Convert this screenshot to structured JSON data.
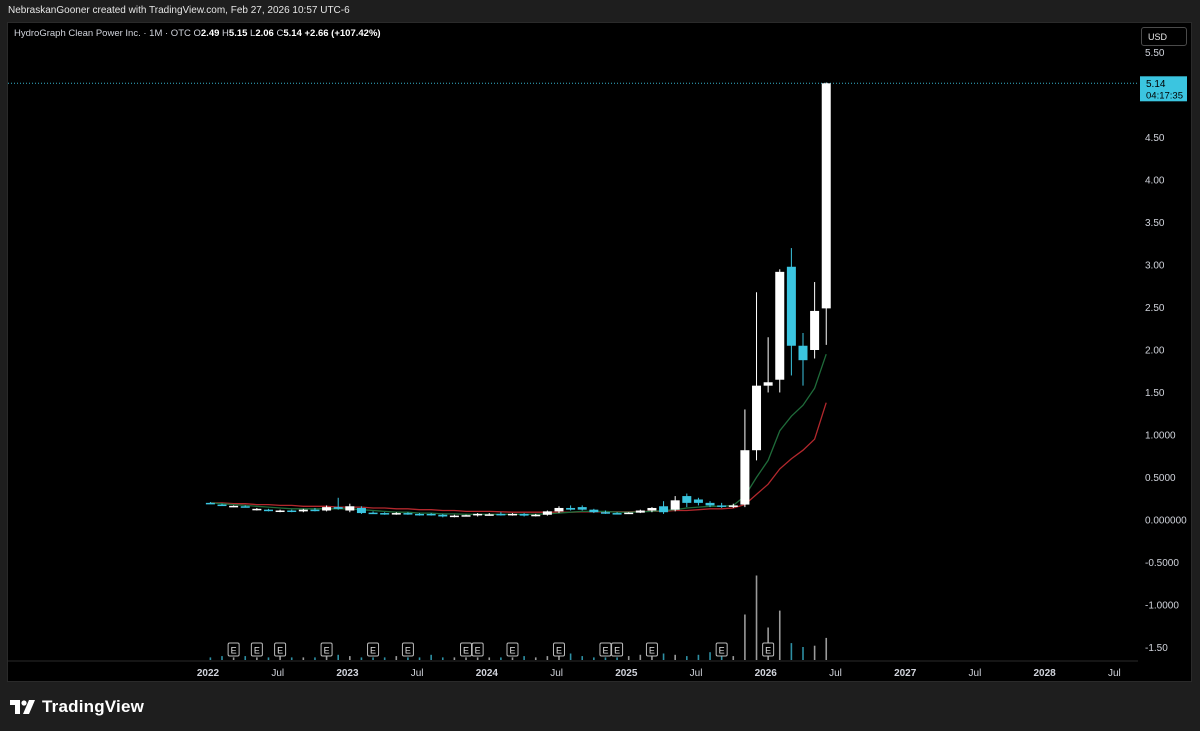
{
  "header": {
    "attribution": "NebraskanGooner created with TradingView.com, Feb 27, 2026 10:57 UTC-6"
  },
  "legend": {
    "symbol": "HydroGraph Clean Power Inc. · 1M · OTC",
    "o_label": "O",
    "o": "2.49",
    "h_label": "H",
    "h": "5.15",
    "l_label": "L",
    "l": "2.06",
    "c_label": "C",
    "c": "5.14",
    "change": "+2.66 (+107.42%)"
  },
  "currency_button": "USD",
  "price_tag": {
    "price": "5.14",
    "countdown": "04:17:35"
  },
  "brand": "TradingView",
  "colors": {
    "background": "#000000",
    "up_candle": "#ffffff",
    "down_candle": "#3bc5e0",
    "ema_fast": "#1f6b3a",
    "ema_slow": "#b3282d",
    "price_line": "#3bc5e0",
    "volume": "#8c8c8c"
  },
  "chart_data": {
    "type": "candlestick",
    "interval": "1M",
    "y_range": [
      -1.65,
      5.85
    ],
    "y_ticks": [
      "5.50",
      "4.50",
      "4.00",
      "3.50",
      "3.00",
      "2.50",
      "2.00",
      "1.50",
      "1.0000",
      "0.5000",
      "0.000000",
      "-0.5000",
      "-1.0000",
      "-1.50"
    ],
    "x_ticks": [
      {
        "label": "2022",
        "month": 0
      },
      {
        "label": "Jul",
        "month": 6
      },
      {
        "label": "2023",
        "month": 12
      },
      {
        "label": "Jul",
        "month": 18
      },
      {
        "label": "2024",
        "month": 24
      },
      {
        "label": "Jul",
        "month": 30
      },
      {
        "label": "2025",
        "month": 36
      },
      {
        "label": "Jul",
        "month": 42
      },
      {
        "label": "2026",
        "month": 48
      },
      {
        "label": "Jul",
        "month": 54
      },
      {
        "label": "2027",
        "month": 60
      },
      {
        "label": "Jul",
        "month": 66
      },
      {
        "label": "2028",
        "month": 72
      },
      {
        "label": "Jul",
        "month": 78
      }
    ],
    "candles": [
      {
        "date": "2021-12",
        "o": 0.2,
        "h": 0.21,
        "l": 0.19,
        "c": 0.195
      },
      {
        "date": "2022-01",
        "o": 0.18,
        "h": 0.19,
        "l": 0.17,
        "c": 0.175
      },
      {
        "date": "2022-02",
        "o": 0.16,
        "h": 0.17,
        "l": 0.15,
        "c": 0.165
      },
      {
        "date": "2022-03",
        "o": 0.16,
        "h": 0.17,
        "l": 0.15,
        "c": 0.155
      },
      {
        "date": "2022-04",
        "o": 0.12,
        "h": 0.14,
        "l": 0.11,
        "c": 0.13
      },
      {
        "date": "2022-05",
        "o": 0.12,
        "h": 0.13,
        "l": 0.1,
        "c": 0.105
      },
      {
        "date": "2022-06",
        "o": 0.105,
        "h": 0.12,
        "l": 0.09,
        "c": 0.11
      },
      {
        "date": "2022-07",
        "o": 0.11,
        "h": 0.12,
        "l": 0.09,
        "c": 0.1
      },
      {
        "date": "2022-08",
        "o": 0.1,
        "h": 0.13,
        "l": 0.09,
        "c": 0.12
      },
      {
        "date": "2022-09",
        "o": 0.12,
        "h": 0.14,
        "l": 0.1,
        "c": 0.11
      },
      {
        "date": "2022-10",
        "o": 0.11,
        "h": 0.17,
        "l": 0.1,
        "c": 0.15
      },
      {
        "date": "2022-11",
        "o": 0.15,
        "h": 0.26,
        "l": 0.12,
        "c": 0.13
      },
      {
        "date": "2022-12",
        "o": 0.11,
        "h": 0.19,
        "l": 0.09,
        "c": 0.16
      },
      {
        "date": "2023-01",
        "o": 0.14,
        "h": 0.16,
        "l": 0.07,
        "c": 0.08
      },
      {
        "date": "2023-02",
        "o": 0.085,
        "h": 0.1,
        "l": 0.07,
        "c": 0.08
      },
      {
        "date": "2023-03",
        "o": 0.08,
        "h": 0.09,
        "l": 0.06,
        "c": 0.075
      },
      {
        "date": "2023-04",
        "o": 0.07,
        "h": 0.09,
        "l": 0.06,
        "c": 0.08
      },
      {
        "date": "2023-05",
        "o": 0.08,
        "h": 0.09,
        "l": 0.06,
        "c": 0.07
      },
      {
        "date": "2023-06",
        "o": 0.07,
        "h": 0.08,
        "l": 0.05,
        "c": 0.06
      },
      {
        "date": "2023-07",
        "o": 0.07,
        "h": 0.08,
        "l": 0.05,
        "c": 0.055
      },
      {
        "date": "2023-08",
        "o": 0.06,
        "h": 0.07,
        "l": 0.03,
        "c": 0.04
      },
      {
        "date": "2023-09",
        "o": 0.04,
        "h": 0.06,
        "l": 0.03,
        "c": 0.05
      },
      {
        "date": "2023-10",
        "o": 0.05,
        "h": 0.06,
        "l": 0.04,
        "c": 0.055
      },
      {
        "date": "2023-11",
        "o": 0.055,
        "h": 0.08,
        "l": 0.04,
        "c": 0.07
      },
      {
        "date": "2023-12",
        "o": 0.06,
        "h": 0.08,
        "l": 0.05,
        "c": 0.065
      },
      {
        "date": "2024-01",
        "o": 0.07,
        "h": 0.09,
        "l": 0.05,
        "c": 0.06
      },
      {
        "date": "2024-02",
        "o": 0.06,
        "h": 0.08,
        "l": 0.05,
        "c": 0.07
      },
      {
        "date": "2024-03",
        "o": 0.07,
        "h": 0.08,
        "l": 0.04,
        "c": 0.05
      },
      {
        "date": "2024-04",
        "o": 0.05,
        "h": 0.07,
        "l": 0.04,
        "c": 0.06
      },
      {
        "date": "2024-05",
        "o": 0.06,
        "h": 0.11,
        "l": 0.05,
        "c": 0.1
      },
      {
        "date": "2024-06",
        "o": 0.1,
        "h": 0.16,
        "l": 0.08,
        "c": 0.14
      },
      {
        "date": "2024-07",
        "o": 0.14,
        "h": 0.17,
        "l": 0.11,
        "c": 0.12
      },
      {
        "date": "2024-08",
        "o": 0.15,
        "h": 0.17,
        "l": 0.11,
        "c": 0.12
      },
      {
        "date": "2024-09",
        "o": 0.12,
        "h": 0.13,
        "l": 0.08,
        "c": 0.09
      },
      {
        "date": "2024-10",
        "o": 0.09,
        "h": 0.11,
        "l": 0.07,
        "c": 0.08
      },
      {
        "date": "2024-11",
        "o": 0.08,
        "h": 0.09,
        "l": 0.07,
        "c": 0.075
      },
      {
        "date": "2024-12",
        "o": 0.08,
        "h": 0.09,
        "l": 0.07,
        "c": 0.085
      },
      {
        "date": "2025-01",
        "o": 0.085,
        "h": 0.12,
        "l": 0.08,
        "c": 0.11
      },
      {
        "date": "2025-02",
        "o": 0.11,
        "h": 0.15,
        "l": 0.09,
        "c": 0.14
      },
      {
        "date": "2025-03",
        "o": 0.16,
        "h": 0.22,
        "l": 0.07,
        "c": 0.09
      },
      {
        "date": "2025-04",
        "o": 0.12,
        "h": 0.28,
        "l": 0.1,
        "c": 0.23
      },
      {
        "date": "2025-05",
        "o": 0.28,
        "h": 0.31,
        "l": 0.15,
        "c": 0.2
      },
      {
        "date": "2025-06",
        "o": 0.24,
        "h": 0.26,
        "l": 0.17,
        "c": 0.2
      },
      {
        "date": "2025-07",
        "o": 0.2,
        "h": 0.22,
        "l": 0.15,
        "c": 0.17
      },
      {
        "date": "2025-08",
        "o": 0.17,
        "h": 0.2,
        "l": 0.14,
        "c": 0.16
      },
      {
        "date": "2025-09",
        "o": 0.16,
        "h": 0.19,
        "l": 0.14,
        "c": 0.17
      },
      {
        "date": "2025-10",
        "o": 0.18,
        "h": 1.3,
        "l": 0.15,
        "c": 0.82
      },
      {
        "date": "2025-11",
        "o": 0.82,
        "h": 2.68,
        "l": 0.7,
        "c": 1.58
      },
      {
        "date": "2025-12",
        "o": 1.58,
        "h": 2.15,
        "l": 1.5,
        "c": 1.62
      },
      {
        "date": "2026-01",
        "o": 1.65,
        "h": 2.95,
        "l": 1.5,
        "c": 2.92
      },
      {
        "date": "2026-02",
        "o": 2.98,
        "h": 3.2,
        "l": 1.7,
        "c": 2.05
      },
      {
        "date": "2026-03",
        "o": 2.05,
        "h": 2.2,
        "l": 1.58,
        "c": 1.88
      },
      {
        "date": "2026-04",
        "o": 2.0,
        "h": 2.8,
        "l": 1.9,
        "c": 2.46
      },
      {
        "date": "2026-05",
        "o": 2.49,
        "h": 5.15,
        "l": 2.06,
        "c": 5.14
      }
    ],
    "ema_fast": [
      0.2,
      0.19,
      0.18,
      0.17,
      0.16,
      0.15,
      0.14,
      0.13,
      0.13,
      0.13,
      0.13,
      0.13,
      0.13,
      0.12,
      0.11,
      0.1,
      0.09,
      0.09,
      0.08,
      0.08,
      0.07,
      0.07,
      0.065,
      0.065,
      0.065,
      0.065,
      0.065,
      0.065,
      0.065,
      0.07,
      0.08,
      0.09,
      0.1,
      0.1,
      0.1,
      0.09,
      0.09,
      0.095,
      0.1,
      0.11,
      0.12,
      0.14,
      0.15,
      0.16,
      0.16,
      0.17,
      0.28,
      0.5,
      0.7,
      1.05,
      1.22,
      1.35,
      1.55,
      1.95
    ],
    "ema_slow": [
      0.2,
      0.2,
      0.19,
      0.19,
      0.18,
      0.18,
      0.17,
      0.17,
      0.16,
      0.16,
      0.16,
      0.15,
      0.15,
      0.15,
      0.14,
      0.14,
      0.13,
      0.13,
      0.12,
      0.12,
      0.11,
      0.11,
      0.1,
      0.1,
      0.1,
      0.095,
      0.09,
      0.09,
      0.09,
      0.09,
      0.09,
      0.09,
      0.095,
      0.095,
      0.095,
      0.095,
      0.095,
      0.1,
      0.1,
      0.1,
      0.11,
      0.11,
      0.12,
      0.13,
      0.13,
      0.14,
      0.18,
      0.3,
      0.42,
      0.6,
      0.72,
      0.82,
      0.95,
      1.38
    ],
    "volume": [
      0.02,
      0.03,
      0.02,
      0.03,
      0.02,
      0.02,
      0.03,
      0.02,
      0.02,
      0.02,
      0.03,
      0.04,
      0.03,
      0.02,
      0.02,
      0.02,
      0.03,
      0.02,
      0.02,
      0.04,
      0.02,
      0.02,
      0.02,
      0.02,
      0.02,
      0.02,
      0.02,
      0.03,
      0.02,
      0.03,
      0.03,
      0.05,
      0.03,
      0.02,
      0.02,
      0.02,
      0.03,
      0.04,
      0.03,
      0.05,
      0.04,
      0.03,
      0.04,
      0.06,
      0.03,
      0.03,
      0.35,
      0.65,
      0.25,
      0.38,
      0.13,
      0.1,
      0.11,
      0.17
    ],
    "earnings_months": [
      1,
      3,
      5,
      9,
      13,
      16,
      21,
      22,
      25,
      29,
      33,
      34,
      37,
      43,
      47
    ]
  }
}
